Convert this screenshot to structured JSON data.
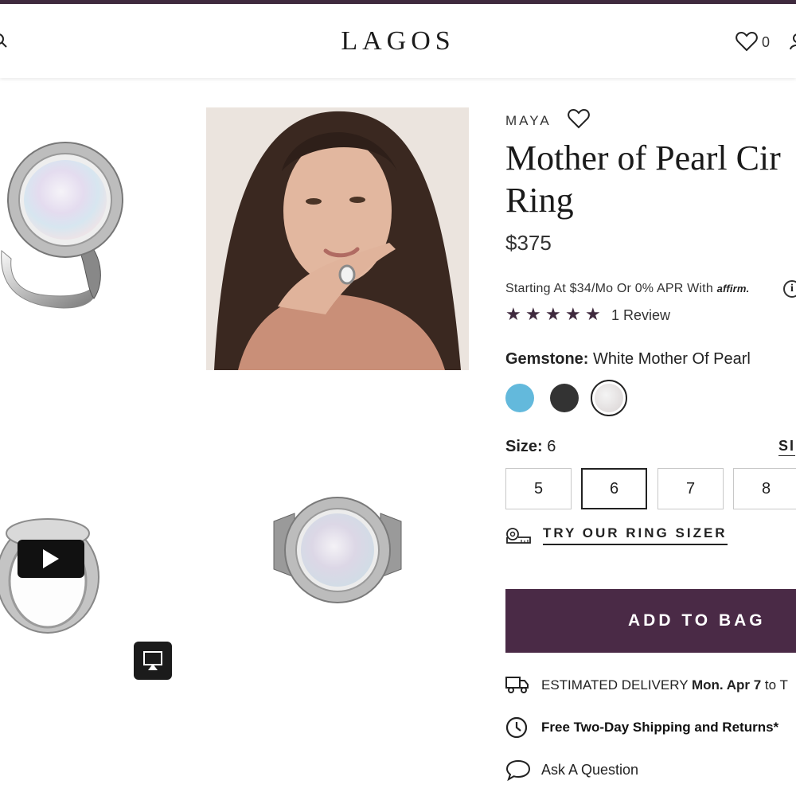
{
  "header": {
    "logo": "LAGOS",
    "wishlist_count": "0",
    "icons": [
      "search-icon",
      "heart-icon",
      "account-icon"
    ],
    "stripe_color": "#3f2a3e"
  },
  "gallery": {
    "video_icon": "play-icon",
    "airplay_icon": "airplay-icon"
  },
  "product": {
    "collection": "MAYA",
    "title_line1": "Mother of Pearl Cir",
    "title_line2": "Ring",
    "price": "$375",
    "financing_prefix": "Starting At $34/Mo Or 0% APR With",
    "financing_brand": "affirm.",
    "info_glyph": "i",
    "rating": 5,
    "star_glyph": "★",
    "review_text": "1 Review",
    "gemstone_label": "Gemstone:",
    "gemstone_value": "White Mother Of Pearl",
    "swatch_colors": {
      "turquoise": "#63b9dc",
      "onyx": "#333333",
      "pearl": "#e6e1e1"
    },
    "size_label": "Size:",
    "size_value": "6",
    "size_guide": "SI",
    "sizes": [
      "5",
      "6",
      "7",
      "8"
    ],
    "selected_size": "6",
    "ring_sizer": "TRY OUR RING SIZER",
    "add_to_bag": "ADD TO BAG",
    "accent_color": "#4a2a46",
    "delivery_prefix": "ESTIMATED DELIVERY",
    "delivery_date": "Mon. Apr 7",
    "delivery_suffix": "to T",
    "shipping": "Free Two-Day Shipping and Returns*",
    "ask": "Ask A Question"
  }
}
